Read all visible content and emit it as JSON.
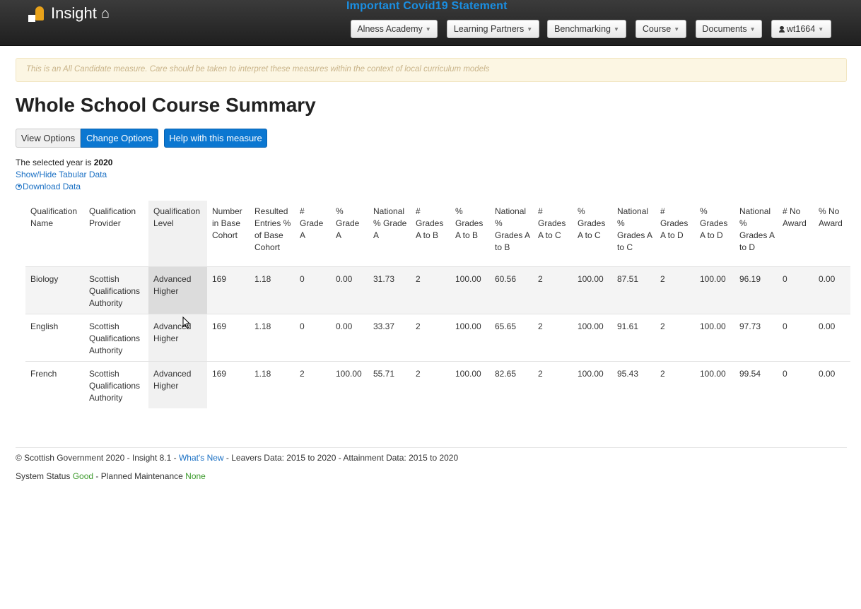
{
  "navbar": {
    "brand": "Insight",
    "statement": "Important Covid19 Statement",
    "menus": [
      {
        "label": "Alness Academy"
      },
      {
        "label": "Learning Partners"
      },
      {
        "label": "Benchmarking"
      },
      {
        "label": "Course"
      },
      {
        "label": "Documents"
      },
      {
        "label": "wt1664"
      }
    ]
  },
  "warning": "This is an All Candidate measure. Care should be taken to interpret these measures within the context of local curriculum models",
  "page_title": "Whole School Course Summary",
  "buttons": {
    "view_options": "View Options",
    "change_options": "Change Options",
    "help": "Help with this measure"
  },
  "year": {
    "prefix": "The selected year is",
    "value": "2020"
  },
  "links": {
    "show_hide": "Show/Hide Tabular Data",
    "download": "Download Data"
  },
  "table": {
    "headers": [
      "Qualification Name",
      "Qualification Provider",
      "Qualification Level",
      "Number in Base Cohort",
      "Resulted Entries % of Base Cohort",
      "# Grade A",
      "% Grade A",
      "National % Grade A",
      "# Grades A to B",
      "% Grades A to B",
      "National % Grades A to B",
      "# Grades A to C",
      "% Grades A to C",
      "National % Grades A to C",
      "# Grades A to D",
      "% Grades A to D",
      "National % Grades A to D",
      "# No Award",
      "% No Award"
    ],
    "rows": [
      [
        "Biology",
        "Scottish Qualifications Authority",
        "Advanced Higher",
        "169",
        "1.18",
        "0",
        "0.00",
        "31.73",
        "2",
        "100.00",
        "60.56",
        "2",
        "100.00",
        "87.51",
        "2",
        "100.00",
        "96.19",
        "0",
        "0.00"
      ],
      [
        "English",
        "Scottish Qualifications Authority",
        "Advanced Higher",
        "169",
        "1.18",
        "0",
        "0.00",
        "33.37",
        "2",
        "100.00",
        "65.65",
        "2",
        "100.00",
        "91.61",
        "2",
        "100.00",
        "97.73",
        "0",
        "0.00"
      ],
      [
        "French",
        "Scottish Qualifications Authority",
        "Advanced Higher",
        "169",
        "1.18",
        "2",
        "100.00",
        "55.71",
        "2",
        "100.00",
        "82.65",
        "2",
        "100.00",
        "95.43",
        "2",
        "100.00",
        "99.54",
        "0",
        "0.00"
      ]
    ]
  },
  "footer": {
    "copyright": "© Scottish Government 2020 - Insight 8.1 - ",
    "whats_new": "What's New",
    "data_info": " - Leavers Data: 2015 to 2020 - Attainment Data: 2015 to 2020",
    "status_label": "System Status ",
    "status_value": "Good",
    "maintenance_label": " - Planned Maintenance ",
    "maintenance_value": "None"
  }
}
